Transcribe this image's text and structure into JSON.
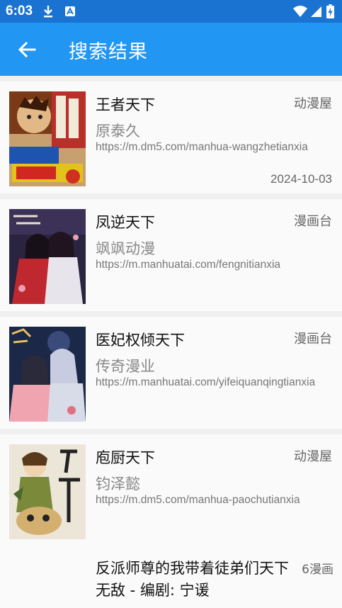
{
  "statusbar": {
    "time": "6:03"
  },
  "appbar": {
    "title": "搜索结果"
  },
  "results": [
    {
      "name": "王者天下",
      "source": "动漫屋",
      "author": "原泰久",
      "url": "https://m.dm5.com/manhua-wangzhetianxia",
      "date": "2024-10-03"
    },
    {
      "name": "凤逆天下",
      "source": "漫画台",
      "author": "飒飒动漫",
      "url": "https://m.manhuatai.com/fengnitianxia"
    },
    {
      "name": "医妃权倾天下",
      "source": "漫画台",
      "author": "传奇漫业",
      "url": "https://m.manhuatai.com/yifeiquanqingtianxia"
    },
    {
      "name": "庖厨天下",
      "source": "动漫屋",
      "author": "钧泽懿",
      "url": "https://m.dm5.com/manhua-paochutianxia"
    },
    {
      "name": "反派师尊的我带着徒弟们天下无敌 - 编剧: 宁谖",
      "source": "6漫画"
    }
  ],
  "colors": {
    "appbar": "#2196f3",
    "statusbar": "#1a73d1"
  }
}
